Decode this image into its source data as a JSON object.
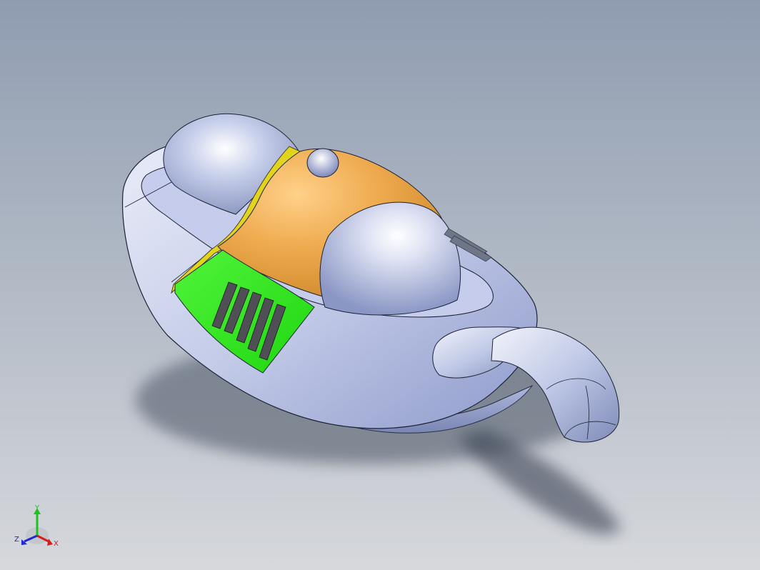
{
  "viewport": {
    "view": "isometric",
    "display_style": "shaded-with-edges",
    "background_colors": [
      "#8f9cb0",
      "#b6bdc8",
      "#d6d8dc"
    ]
  },
  "model": {
    "parts": [
      {
        "name": "body-shell",
        "color": "#b8c2e0"
      },
      {
        "name": "top-cover",
        "color": "#e8a64a"
      },
      {
        "name": "side-grill-panel",
        "color": "#2ee81f"
      },
      {
        "name": "yellow-trim",
        "color": "#e2d31d"
      },
      {
        "name": "intake-hose",
        "color": "#b8c2e0"
      }
    ]
  },
  "triad": {
    "x_label": "X",
    "y_label": "Y",
    "z_label": "Z",
    "x_color": "#d21e1e",
    "y_color": "#1ec21e",
    "z_color": "#1e2ad2"
  }
}
